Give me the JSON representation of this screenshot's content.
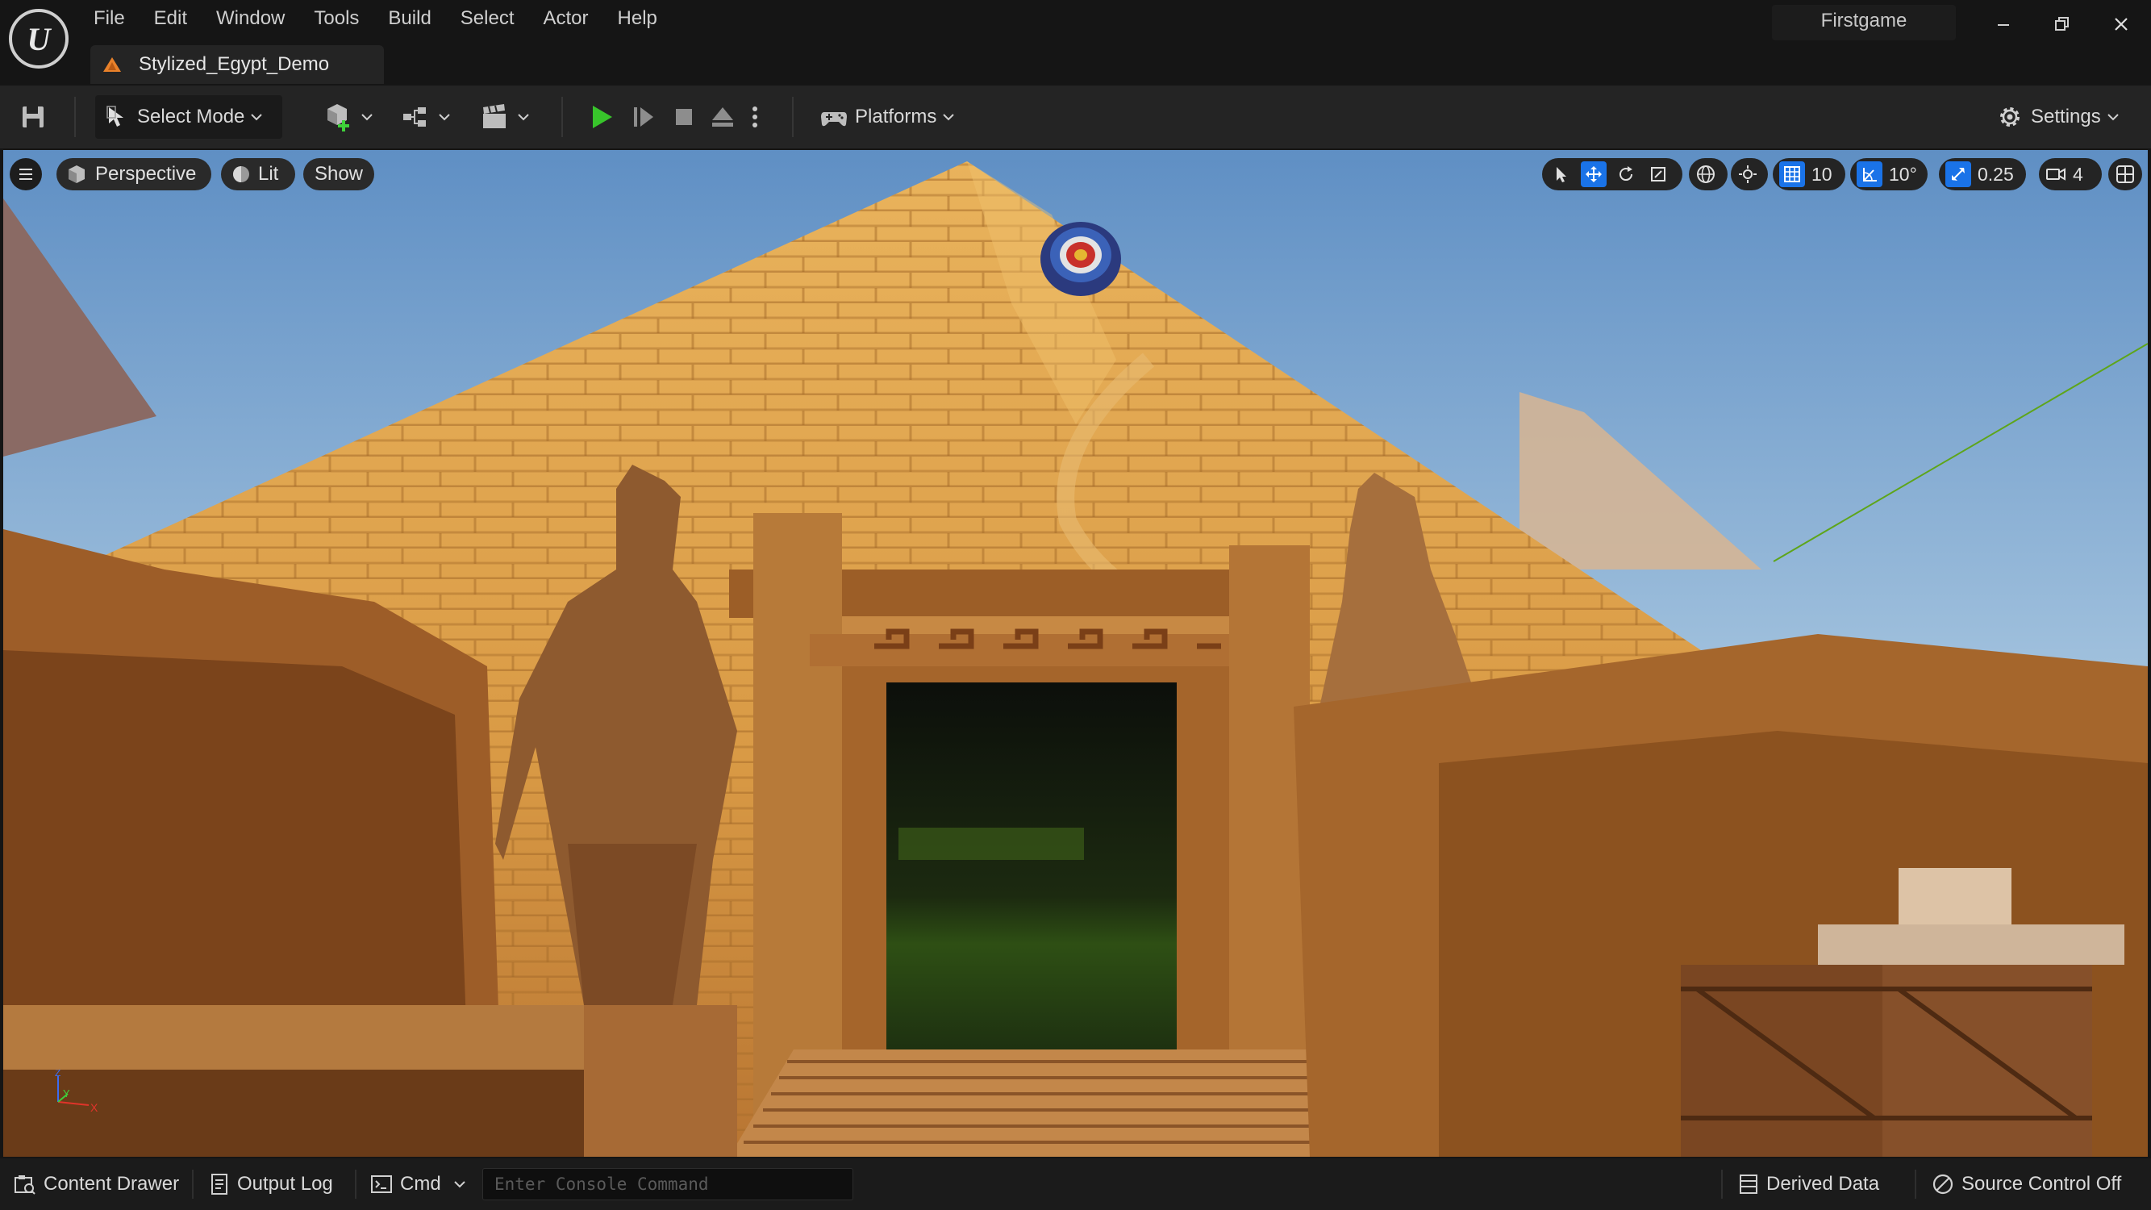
{
  "app": {
    "project_name": "Firstgame",
    "level_tab": "Stylized_Egypt_Demo"
  },
  "menu": [
    "File",
    "Edit",
    "Window",
    "Tools",
    "Build",
    "Select",
    "Actor",
    "Help"
  ],
  "toolbar": {
    "select_mode": "Select Mode",
    "platforms": "Platforms",
    "settings": "Settings"
  },
  "viewport": {
    "perspective": "Perspective",
    "lit": "Lit",
    "show": "Show",
    "grid_snap": "10",
    "rotation_snap": "10°",
    "scale_snap": "0.25",
    "camera_speed": "4"
  },
  "statusbar": {
    "content_drawer": "Content Drawer",
    "output_log": "Output Log",
    "cmd": "Cmd",
    "console_placeholder": "Enter Console Command",
    "derived_data": "Derived Data",
    "source_control": "Source Control Off"
  },
  "icons": {
    "play_color": "#38c52b",
    "accent": "#1a73e8"
  }
}
